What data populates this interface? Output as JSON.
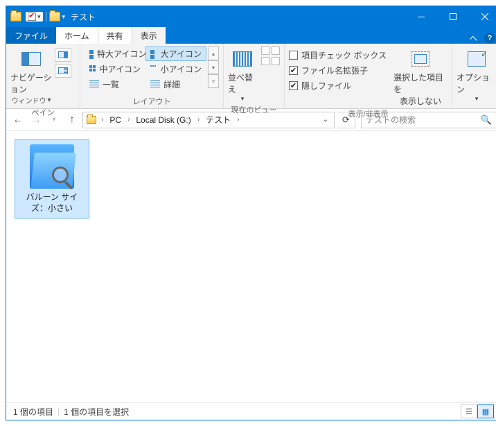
{
  "window": {
    "title": "テスト"
  },
  "tabs": {
    "file": "ファイル",
    "home": "ホーム",
    "share": "共有",
    "view": "表示"
  },
  "ribbon": {
    "panes": {
      "nav_label_line1": "ナビゲーション",
      "nav_label_line2": "ウィンドウ",
      "group": "ペイン"
    },
    "layout": {
      "extra_large": "特大アイコン",
      "large": "大アイコン",
      "medium": "中アイコン",
      "small": "小アイコン",
      "list": "一覧",
      "details": "詳細",
      "group": "レイアウト"
    },
    "current_view": {
      "sort": "並べ替え",
      "group": "現在のビュー"
    },
    "showhide": {
      "checkboxes": "項目チェック ボックス",
      "extensions": "ファイル名拡張子",
      "hidden": "隠しファイル",
      "hide_label_line1": "選択した項目を",
      "hide_label_line2": "表示しない",
      "group": "表示/非表示"
    },
    "options": "オプション"
  },
  "breadcrumb": {
    "pc": "PC",
    "drive": "Local Disk (G:)",
    "folder": "テスト"
  },
  "search": {
    "placeholder": "テストの検索"
  },
  "items": [
    {
      "name": "バルーン サイズ：小さい"
    }
  ],
  "status": {
    "count": "1 個の項目",
    "selected": "1 個の項目を選択"
  }
}
